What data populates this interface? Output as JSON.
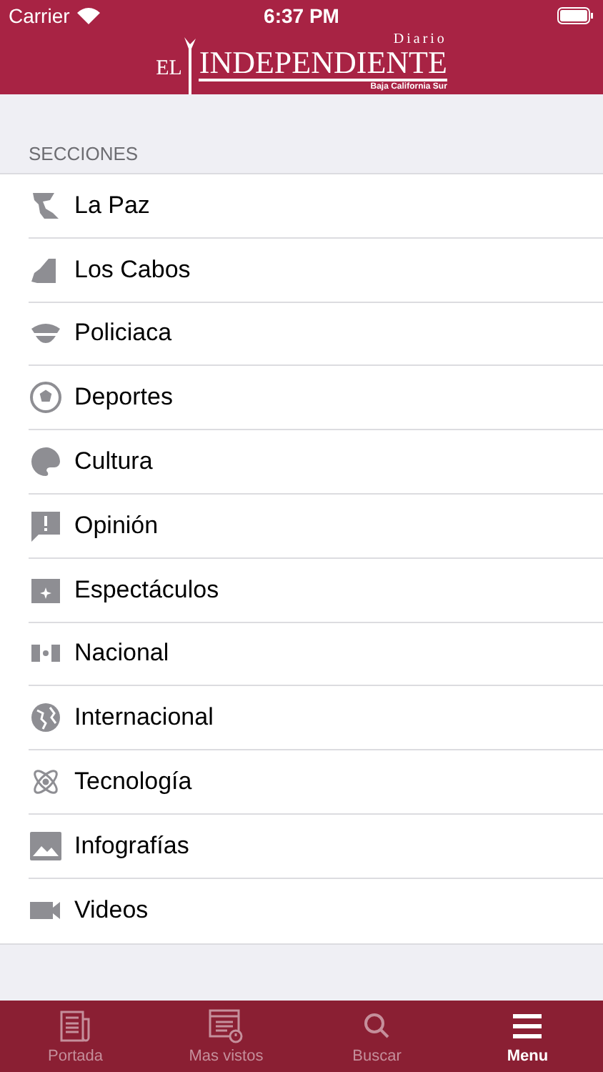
{
  "status_bar": {
    "carrier": "Carrier",
    "time": "6:37 PM"
  },
  "logo": {
    "prefix": "EL",
    "name": "INDEPENDIENTE",
    "top": "Diario",
    "tagline": "Baja California Sur"
  },
  "section_header": "SECCIONES",
  "sections": [
    {
      "label": "La Paz",
      "kind": "map1"
    },
    {
      "label": "Los Cabos",
      "kind": "map2"
    },
    {
      "label": "Policiaca",
      "kind": "cap"
    },
    {
      "label": "Deportes",
      "kind": "ball"
    },
    {
      "label": "Cultura",
      "kind": "palette"
    },
    {
      "label": "Opinión",
      "kind": "comment"
    },
    {
      "label": "Espectáculos",
      "kind": "clapper"
    },
    {
      "label": "Nacional",
      "kind": "flag"
    },
    {
      "label": "Internacional",
      "kind": "globe"
    },
    {
      "label": "Tecnología",
      "kind": "atom"
    },
    {
      "label": "Infografías",
      "kind": "image"
    },
    {
      "label": "Videos",
      "kind": "video"
    }
  ],
  "tabs": [
    {
      "label": "Portada",
      "kind": "newspaper",
      "selected": false
    },
    {
      "label": "Mas vistos",
      "kind": "list",
      "selected": false
    },
    {
      "label": "Buscar",
      "kind": "search",
      "selected": false
    },
    {
      "label": "Menu",
      "kind": "menu",
      "selected": true
    }
  ]
}
